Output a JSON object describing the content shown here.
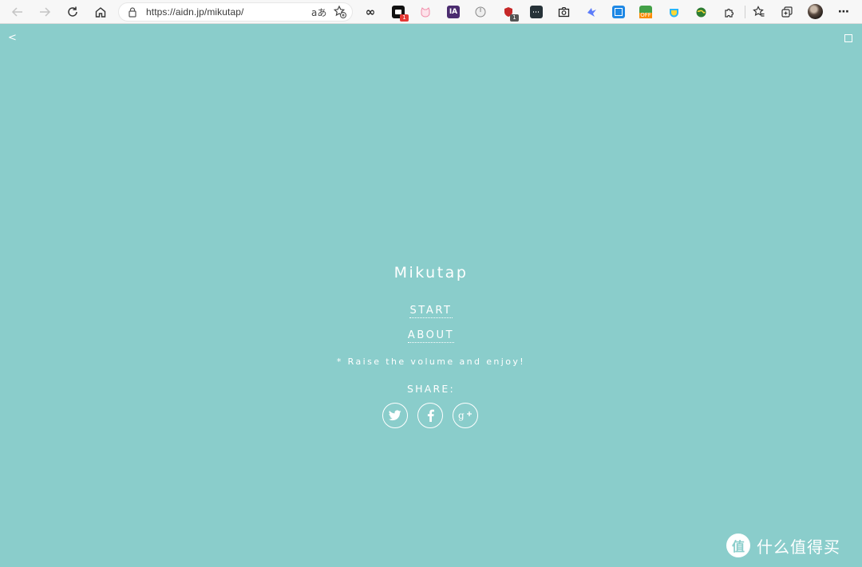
{
  "browser": {
    "url": "https://aidn.jp/mikutap/",
    "reader_mode_label": "aあ",
    "extensions": [
      {
        "name": "infinity-icon",
        "label": "∞",
        "badge": ""
      },
      {
        "name": "todo-extension-icon",
        "label": "",
        "badge": "1"
      },
      {
        "name": "cat-extension-icon",
        "label": "",
        "badge": ""
      },
      {
        "name": "ia-extension-icon",
        "label": "IA",
        "badge": ""
      },
      {
        "name": "mouse-extension-icon",
        "label": "",
        "badge": ""
      },
      {
        "name": "shield-extension-icon",
        "label": "",
        "badge": "1"
      },
      {
        "name": "terminal-extension-icon",
        "label": "",
        "badge": ""
      },
      {
        "name": "screenshot-extension-icon",
        "label": "",
        "badge": ""
      },
      {
        "name": "bird-extension-icon",
        "label": "",
        "badge": ""
      },
      {
        "name": "translate-extension-icon",
        "label": "",
        "badge": ""
      },
      {
        "name": "off-extension-icon",
        "label": "OFF",
        "badge": ""
      },
      {
        "name": "honey-extension-icon",
        "label": "",
        "badge": ""
      },
      {
        "name": "globe-extension-icon",
        "label": "",
        "badge": ""
      }
    ]
  },
  "page": {
    "title": "Mikutap",
    "start_label": "START",
    "about_label": "ABOUT",
    "note": "* Raise the volume and enjoy!",
    "share_label": "SHARE:",
    "back_label": "<",
    "watermark_logo": "值",
    "watermark_text": "什么值得买"
  },
  "colors": {
    "background": "#8acdcb",
    "foreground": "#ffffff"
  }
}
